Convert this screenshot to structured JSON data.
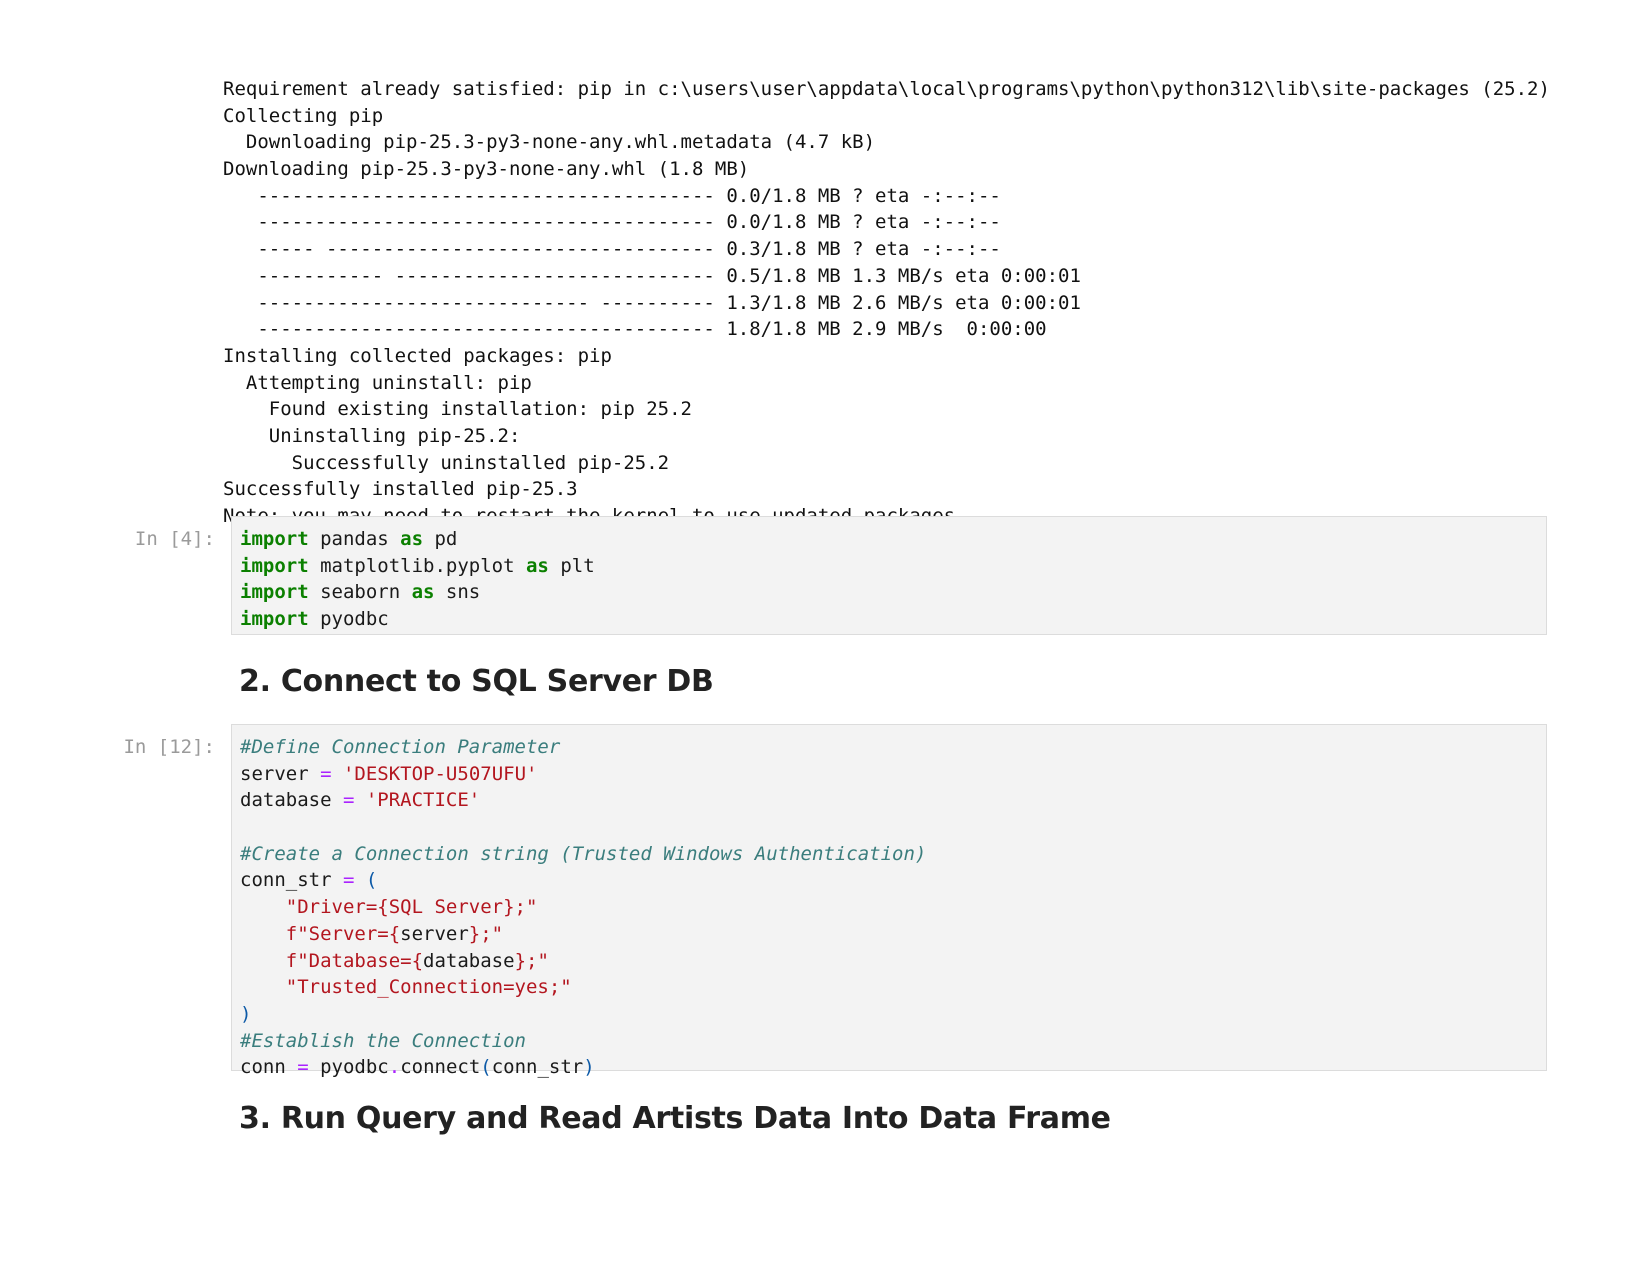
{
  "output_lines": [
    "Requirement already satisfied: pip in c:\\users\\user\\appdata\\local\\programs\\python\\python312\\lib\\site-packages (25.2)",
    "Collecting pip",
    "  Downloading pip-25.3-py3-none-any.whl.metadata (4.7 kB)",
    "Downloading pip-25.3-py3-none-any.whl (1.8 MB)",
    "   ---------------------------------------- 0.0/1.8 MB ? eta -:--:--",
    "   ---------------------------------------- 0.0/1.8 MB ? eta -:--:--",
    "   ----- ---------------------------------- 0.3/1.8 MB ? eta -:--:--",
    "   ----------- ---------------------------- 0.5/1.8 MB 1.3 MB/s eta 0:00:01",
    "   ----------------------------- ---------- 1.3/1.8 MB 2.6 MB/s eta 0:00:01",
    "   ---------------------------------------- 1.8/1.8 MB 2.9 MB/s  0:00:00",
    "Installing collected packages: pip",
    "  Attempting uninstall: pip",
    "    Found existing installation: pip 25.2",
    "    Uninstalling pip-25.2:",
    "      Successfully uninstalled pip-25.2",
    "Successfully installed pip-25.3",
    "Note: you may need to restart the kernel to use updated packages."
  ],
  "cell_imports": {
    "prompt": "In [4]:",
    "lines": [
      [
        {
          "t": "kw",
          "v": "import"
        },
        {
          "t": "id",
          "v": " pandas "
        },
        {
          "t": "kw",
          "v": "as"
        },
        {
          "t": "id",
          "v": " pd"
        }
      ],
      [
        {
          "t": "kw",
          "v": "import"
        },
        {
          "t": "id",
          "v": " matplotlib.pyplot "
        },
        {
          "t": "kw",
          "v": "as"
        },
        {
          "t": "id",
          "v": " plt"
        }
      ],
      [
        {
          "t": "kw",
          "v": "import"
        },
        {
          "t": "id",
          "v": " seaborn "
        },
        {
          "t": "kw",
          "v": "as"
        },
        {
          "t": "id",
          "v": " sns"
        }
      ],
      [
        {
          "t": "kw",
          "v": "import"
        },
        {
          "t": "id",
          "v": " pyodbc"
        }
      ]
    ]
  },
  "heading_connect": "2. Connect to SQL Server DB",
  "cell_connect": {
    "prompt": "In [12]:",
    "lines": [
      [
        {
          "t": "cm",
          "v": "#Define Connection Parameter"
        }
      ],
      [
        {
          "t": "id",
          "v": "server "
        },
        {
          "t": "op",
          "v": "="
        },
        {
          "t": "id",
          "v": " "
        },
        {
          "t": "st",
          "v": "'DESKTOP-U507UFU'"
        }
      ],
      [
        {
          "t": "id",
          "v": "database "
        },
        {
          "t": "op",
          "v": "="
        },
        {
          "t": "id",
          "v": " "
        },
        {
          "t": "st",
          "v": "'PRACTICE'"
        }
      ],
      [],
      [
        {
          "t": "cm",
          "v": "#Create a Connection string (Trusted Windows Authentication)"
        }
      ],
      [
        {
          "t": "id",
          "v": "conn_str "
        },
        {
          "t": "op",
          "v": "="
        },
        {
          "t": "id",
          "v": " "
        },
        {
          "t": "pn",
          "v": "("
        }
      ],
      [
        {
          "t": "id",
          "v": "    "
        },
        {
          "t": "st",
          "v": "\"Driver={SQL Server};\""
        }
      ],
      [
        {
          "t": "id",
          "v": "    "
        },
        {
          "t": "st",
          "v": "f\"Server={"
        },
        {
          "t": "id",
          "v": "server"
        },
        {
          "t": "st",
          "v": "};\""
        }
      ],
      [
        {
          "t": "id",
          "v": "    "
        },
        {
          "t": "st",
          "v": "f\"Database={"
        },
        {
          "t": "id",
          "v": "database"
        },
        {
          "t": "st",
          "v": "};\""
        }
      ],
      [
        {
          "t": "id",
          "v": "    "
        },
        {
          "t": "st",
          "v": "\"Trusted_Connection=yes;\""
        }
      ],
      [
        {
          "t": "pn",
          "v": ")"
        }
      ],
      [
        {
          "t": "cm",
          "v": "#Establish the Connection"
        }
      ],
      [
        {
          "t": "id",
          "v": "conn "
        },
        {
          "t": "op",
          "v": "="
        },
        {
          "t": "id",
          "v": " pyodbc"
        },
        {
          "t": "op",
          "v": "."
        },
        {
          "t": "id",
          "v": "connect"
        },
        {
          "t": "pn",
          "v": "("
        },
        {
          "t": "id",
          "v": "conn_str"
        },
        {
          "t": "pn",
          "v": ")"
        }
      ]
    ]
  },
  "heading_query": "3. Run Query and Read Artists Data Into Data Frame"
}
